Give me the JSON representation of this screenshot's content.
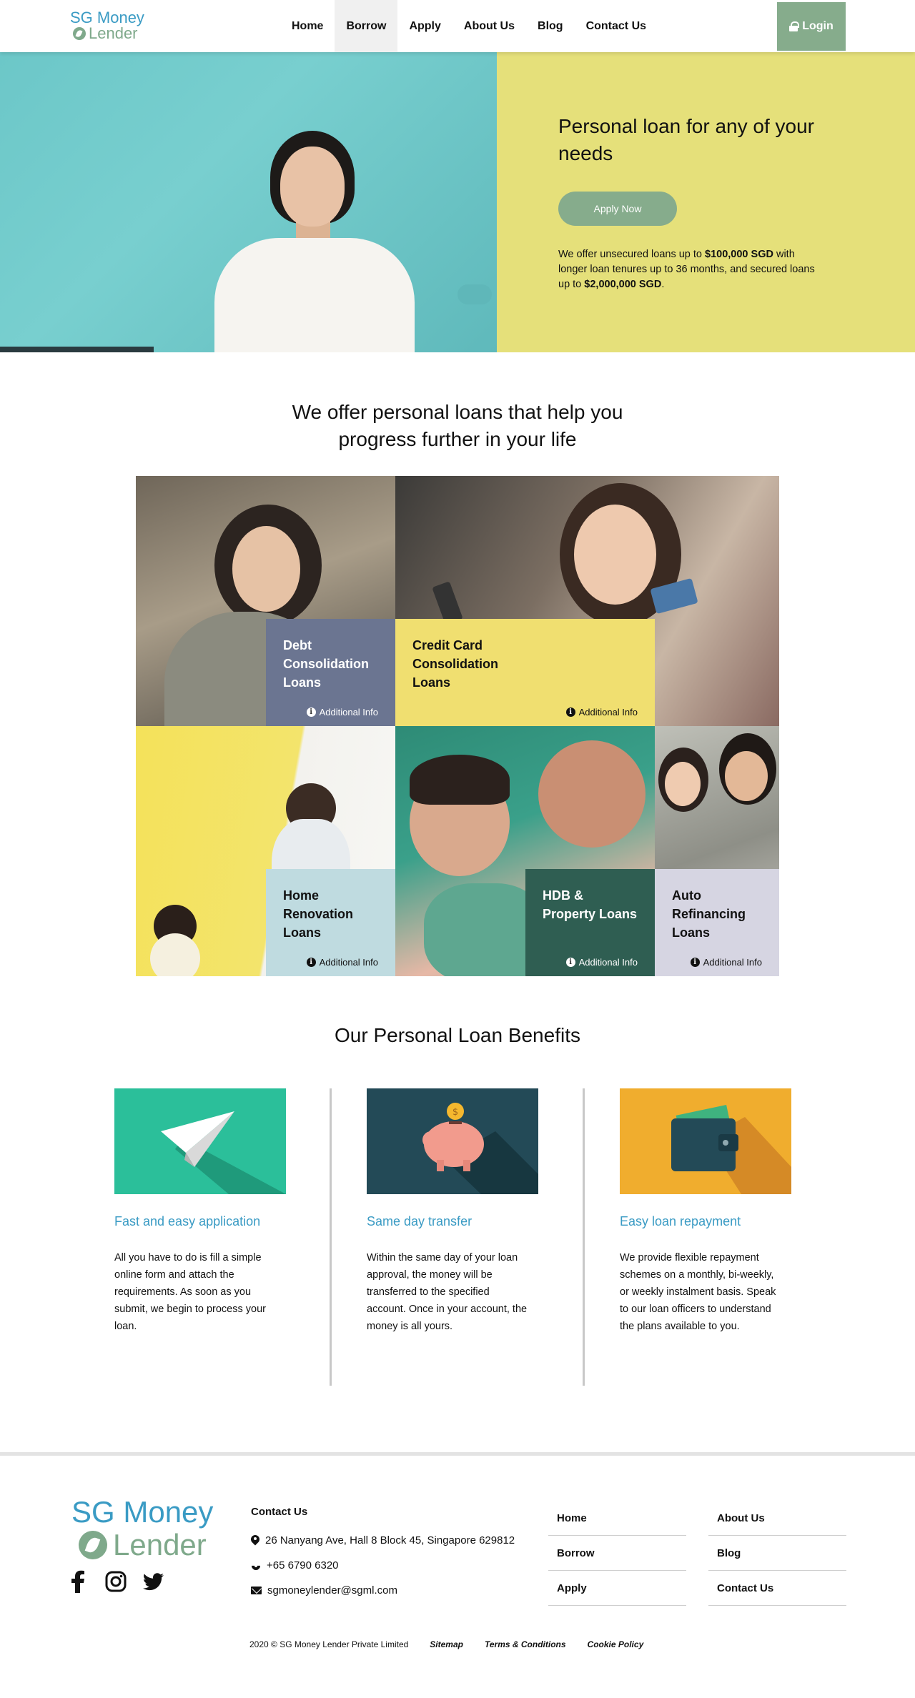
{
  "header": {
    "logo_line1": "SG Money",
    "logo_line2": "Lender",
    "nav": [
      {
        "label": "Home"
      },
      {
        "label": "Borrow"
      },
      {
        "label": "Apply"
      },
      {
        "label": "About Us"
      },
      {
        "label": "Blog"
      },
      {
        "label": "Contact Us"
      }
    ],
    "active_nav": "Borrow",
    "login_label": "Login"
  },
  "hero": {
    "title": "Personal loan for any of your needs",
    "cta_label": "Apply Now",
    "text_part1": "We offer unsecured loans up to ",
    "text_bold1": "$100,000 SGD",
    "text_part2": " with longer loan tenures up to 36 months, and secured loans up to ",
    "text_bold2": "$2,000,000 SGD",
    "text_part3": "."
  },
  "loans_section": {
    "title_line1": "We offer personal loans that help you",
    "title_line2": "progress further in your life",
    "cards": [
      {
        "title": "Debt Consolidation Loans",
        "link": "Additional Info",
        "color": "#6b7591"
      },
      {
        "title": "Credit Card Consolidation Loans",
        "link": "Additional Info",
        "color": "#f0df70"
      },
      {
        "title": "Home Renovation Loans",
        "link": "Additional Info",
        "color": "#bfdbe0"
      },
      {
        "title": "HDB & Property Loans",
        "link": "Additional Info",
        "color": "#2f5e52"
      },
      {
        "title": "Auto Refinancing Loans",
        "link": "Additional Info",
        "color": "#d6d5e2"
      }
    ]
  },
  "benefits_section": {
    "title": "Our Personal Loan Benefits",
    "items": [
      {
        "icon": "paper-plane-icon",
        "bg": "#2bbf9a",
        "title": "Fast and easy application",
        "text": "All you have to do is fill a simple online form and attach the requirements. As soon as you submit, we begin to process your loan."
      },
      {
        "icon": "piggy-bank-icon",
        "bg": "#234a57",
        "title": "Same day transfer",
        "text": "Within the same day of your loan approval, the money will be transferred to the specified account. Once in your account, the money is all yours."
      },
      {
        "icon": "wallet-icon",
        "bg": "#f0ad2e",
        "title": "Easy loan repayment",
        "text": "We provide flexible repayment schemes on a monthly, bi-weekly, or weekly instalment basis. Speak to our loan officers to understand the plans available to you."
      }
    ]
  },
  "footer": {
    "logo_line1": "SG Money",
    "logo_line2": "Lender",
    "social": [
      "facebook-icon",
      "instagram-icon",
      "twitter-icon"
    ],
    "contact_heading": "Contact Us",
    "address": "26 Nanyang Ave, Hall 8 Block 45, Singapore 629812",
    "phone": "+65 6790 6320",
    "email": "sgmoneylender@sgml.com",
    "links_col1": [
      "Home",
      "Borrow",
      "Apply"
    ],
    "links_col2": [
      "About Us",
      "Blog",
      "Contact Us"
    ],
    "copyright": "2020 © SG Money Lender Private Limited",
    "bottom_links": [
      "Sitemap",
      "Terms & Conditions",
      "Cookie Policy"
    ]
  },
  "colors": {
    "brand_blue": "#3a9bc4",
    "brand_green": "#86ac8c",
    "hero_yellow": "#e5e07a",
    "hero_teal": "#6cc7c8"
  }
}
